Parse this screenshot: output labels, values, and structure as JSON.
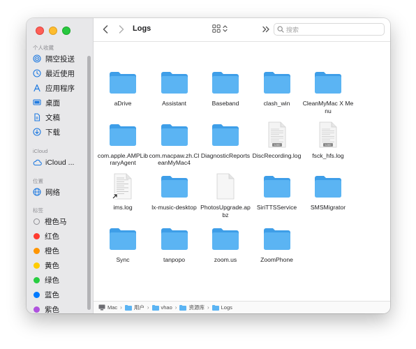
{
  "window": {
    "title": "Logs"
  },
  "sidebar": {
    "favorites_header": "个人收藏",
    "favorites": [
      {
        "label": "隔空投送",
        "icon": "airdrop-icon"
      },
      {
        "label": "最近使用",
        "icon": "clock-icon"
      },
      {
        "label": "应用程序",
        "icon": "applications-icon"
      },
      {
        "label": "桌面",
        "icon": "desktop-icon"
      },
      {
        "label": "文稿",
        "icon": "document-icon"
      },
      {
        "label": "下载",
        "icon": "download-icon"
      }
    ],
    "icloud_header": "iCloud",
    "icloud": [
      {
        "label": "iCloud ...",
        "icon": "cloud-icon"
      }
    ],
    "locations_header": "位置",
    "locations": [
      {
        "label": "网络",
        "icon": "network-icon"
      }
    ],
    "tags_header": "标签",
    "tags": [
      {
        "label": "橙色马",
        "color": "#ffffff"
      },
      {
        "label": "红色",
        "color": "#ff3b30"
      },
      {
        "label": "橙色",
        "color": "#ff9500"
      },
      {
        "label": "黄色",
        "color": "#ffcc00"
      },
      {
        "label": "绿色",
        "color": "#28cd41"
      },
      {
        "label": "蓝色",
        "color": "#007aff"
      },
      {
        "label": "紫色",
        "color": "#af52de"
      }
    ]
  },
  "toolbar": {
    "title": "Logs",
    "search_placeholder": "搜索"
  },
  "files": [
    {
      "name": "aDrive",
      "type": "folder"
    },
    {
      "name": "Assistant",
      "type": "folder"
    },
    {
      "name": "Baseband",
      "type": "folder"
    },
    {
      "name": "clash_win",
      "type": "folder"
    },
    {
      "name": "CleanMyMac X Menu",
      "type": "folder"
    },
    {
      "name": "com.apple.AMPLibraryAgent",
      "type": "folder"
    },
    {
      "name": "com.macpaw.zh.CleanMyMac4",
      "type": "folder"
    },
    {
      "name": "DiagnosticReports",
      "type": "folder"
    },
    {
      "name": "DiscRecording.log",
      "type": "log",
      "badge": "LOG"
    },
    {
      "name": "fsck_hfs.log",
      "type": "log",
      "badge": "LOG"
    },
    {
      "name": "ims.log",
      "type": "alias"
    },
    {
      "name": "lx-music-desktop",
      "type": "folder"
    },
    {
      "name": "PhotosUpgrade.apbz",
      "type": "blank"
    },
    {
      "name": "SiriTTSService",
      "type": "folder"
    },
    {
      "name": "SMSMigrator",
      "type": "folder"
    },
    {
      "name": "Sync",
      "type": "folder"
    },
    {
      "name": "tanpopo",
      "type": "folder"
    },
    {
      "name": "zoom.us",
      "type": "folder"
    },
    {
      "name": "ZoomPhone",
      "type": "folder"
    }
  ],
  "pathbar": [
    "Mac",
    "用户",
    "vhao",
    "资源库",
    "Logs"
  ],
  "colors": {
    "accent": "#1f7ae0",
    "folder": "#5bb4f3",
    "folder_tab": "#3e9ee8"
  }
}
